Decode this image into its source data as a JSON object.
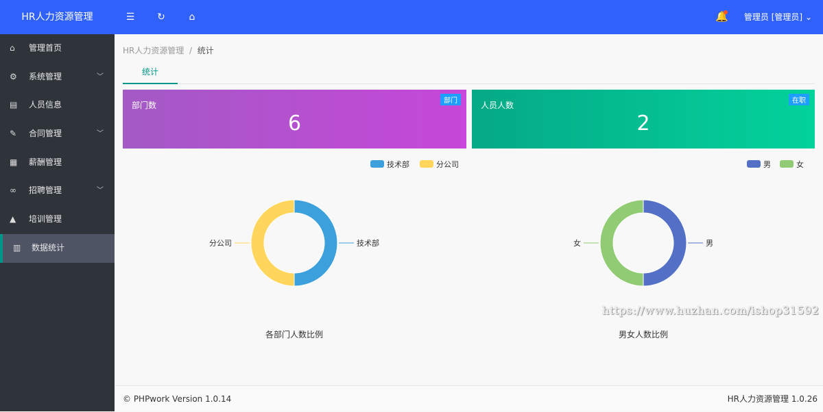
{
  "header": {
    "logo": "HR人力资源管理",
    "user": "管理员 [管理员]"
  },
  "sidebar": {
    "items": [
      {
        "label": "管理首页",
        "icon": "⌂",
        "name": "home-icon",
        "chev": false
      },
      {
        "label": "系统管理",
        "icon": "⚙",
        "name": "gear-icon",
        "chev": true
      },
      {
        "label": "人员信息",
        "icon": "▤",
        "name": "id-card-icon",
        "chev": false
      },
      {
        "label": "合同管理",
        "icon": "✎",
        "name": "contract-icon",
        "chev": true
      },
      {
        "label": "薪酬管理",
        "icon": "▦",
        "name": "salary-icon",
        "chev": false
      },
      {
        "label": "招聘管理",
        "icon": "∞",
        "name": "handshake-icon",
        "chev": true
      },
      {
        "label": "培训管理",
        "icon": "▲",
        "name": "graduation-cap-icon",
        "chev": false
      },
      {
        "label": "数据统计",
        "icon": "▥",
        "name": "bar-chart-icon",
        "chev": false,
        "active": true
      }
    ]
  },
  "breadcrumb": {
    "root": "HR人力资源管理",
    "sep": "/",
    "current": "统计"
  },
  "tab": "统计",
  "cards": [
    {
      "title": "部门数",
      "value": "6",
      "badge": "部门"
    },
    {
      "title": "人员人数",
      "value": "2",
      "badge": "在职"
    }
  ],
  "chart_data": [
    {
      "type": "pie",
      "title": "各部门人数比例",
      "legend": [
        "技术部",
        "分公司"
      ],
      "values": [
        1,
        1
      ],
      "colors": [
        "#3ba0dc",
        "#ffd55c"
      ]
    },
    {
      "type": "pie",
      "title": "男女人数比例",
      "legend": [
        "男",
        "女"
      ],
      "values": [
        1,
        1
      ],
      "colors": [
        "#5470c6",
        "#91cc75"
      ]
    }
  ],
  "watermark": "https://www.huzhan.com/ishop31592",
  "footer": {
    "left": "© PHPwork Version 1.0.14",
    "right": "HR人力资源管理 1.0.26"
  }
}
